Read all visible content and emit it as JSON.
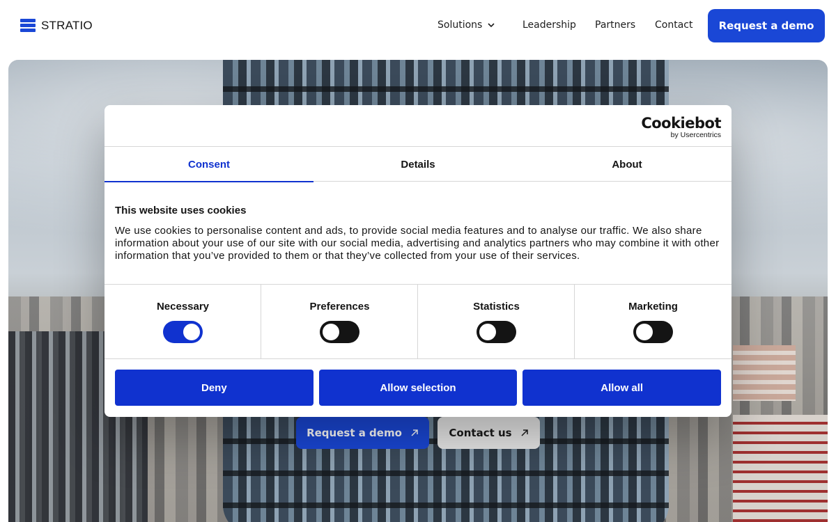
{
  "header": {
    "logo_text": "STRATIO",
    "nav": [
      {
        "label": "Solutions"
      },
      {
        "label": "Leadership"
      },
      {
        "label": "Partners"
      },
      {
        "label": "Contact"
      }
    ],
    "cta_label": "Request a demo"
  },
  "hero": {
    "primary_button": "Request a demo",
    "secondary_button": "Contact us"
  },
  "cookie_dialog": {
    "brand": "Cookiebot",
    "brand_sub": "by Usercentrics",
    "tabs": [
      {
        "label": "Consent",
        "active": true
      },
      {
        "label": "Details",
        "active": false
      },
      {
        "label": "About",
        "active": false
      }
    ],
    "title": "This website uses cookies",
    "body": "We use cookies to personalise content and ads, to provide social media features and to analyse our traffic. We also share information about your use of our site with our social media, advertising and analytics partners who may combine it with other information that you’ve provided to them or that they’ve collected from your use of their services.",
    "categories": [
      {
        "label": "Necessary",
        "enabled": true
      },
      {
        "label": "Preferences",
        "enabled": false
      },
      {
        "label": "Statistics",
        "enabled": false
      },
      {
        "label": "Marketing",
        "enabled": false
      }
    ],
    "buttons": {
      "deny": "Deny",
      "allow_selection": "Allow selection",
      "allow_all": "Allow all"
    }
  },
  "colors": {
    "brand_blue": "#1a47d6",
    "cookiebot_blue": "#1032cf"
  }
}
